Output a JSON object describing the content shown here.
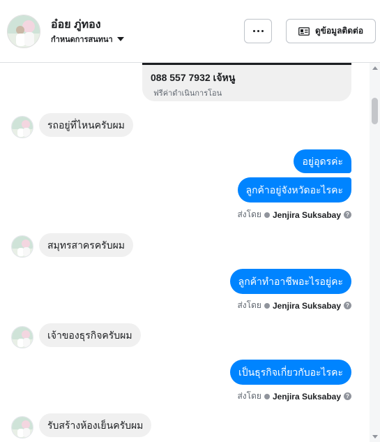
{
  "header": {
    "contact_name": "อ๋อย ภู่ทอง",
    "assign_label": "กำหนดการสนทนา",
    "contact_info_label": "ดูข้อมูลติดต่อ",
    "more_icon": "more-dots-icon",
    "contact_icon": "id-card-icon"
  },
  "attachment": {
    "title": "088 557 7932 เจ้หนู",
    "subtitle": "ฟรีค่าดำเนินการโอน"
  },
  "messages": [
    {
      "direction": "in",
      "text": "รถอยู่ที่ไหนครับผม"
    },
    {
      "direction": "out",
      "text": "อยู่อุดรค่ะ"
    },
    {
      "direction": "out",
      "text": "ลูกค้าอยู่จังหวัดอะไรคะ"
    },
    {
      "direction": "in",
      "text": "สมุทรสาครครับผม"
    },
    {
      "direction": "out",
      "text": "ลูกค้าทำอาชีพอะไรอยู่คะ"
    },
    {
      "direction": "in",
      "text": "เจ้าของธุรกิจครับผม"
    },
    {
      "direction": "out",
      "text": "เป็นธุรกิจเกี่ยวกับอะไรคะ"
    },
    {
      "direction": "in",
      "text": "รับสร้างห้องเย็นครับผม"
    }
  ],
  "sent_by": {
    "prefix": "ส่งโดย",
    "agent": "Jenjira Suksabay",
    "help": "?"
  },
  "colors": {
    "outgoing_bubble": "#0084ff",
    "incoming_bubble": "#f0f0f0"
  }
}
